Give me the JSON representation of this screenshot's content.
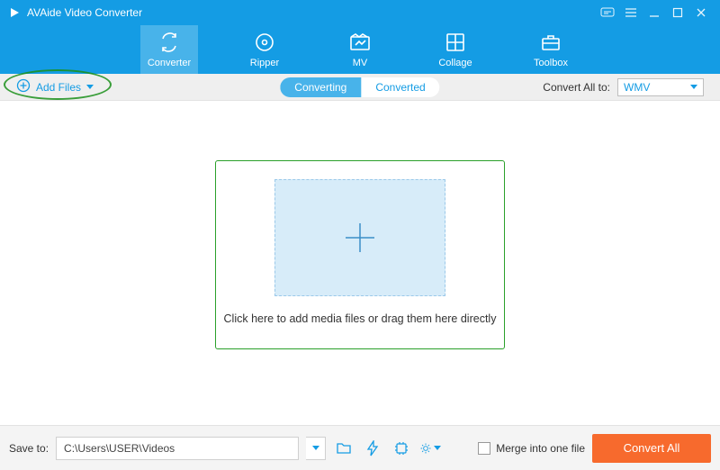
{
  "title": "AVAide Video Converter",
  "tabs": {
    "converter": "Converter",
    "ripper": "Ripper",
    "mv": "MV",
    "collage": "Collage",
    "toolbox": "Toolbox"
  },
  "subbar": {
    "add_files": "Add Files",
    "converting": "Converting",
    "converted": "Converted",
    "convert_all_to": "Convert All to:",
    "format_selected": "WMV"
  },
  "dropzone": {
    "hint": "Click here to add media files or drag them here directly"
  },
  "bottom": {
    "save_to": "Save to:",
    "path": "C:\\Users\\USER\\Videos",
    "merge": "Merge into one file",
    "convert_all": "Convert All"
  },
  "icons": {
    "feedback": "feedback-icon",
    "menu": "menu-icon",
    "minimize": "minimize-icon",
    "maximize": "maximize-icon",
    "close": "close-icon",
    "converter": "converter-icon",
    "ripper": "ripper-icon",
    "mv": "mv-icon",
    "collage": "collage-icon",
    "toolbox": "toolbox-icon",
    "plus_circle": "plus-circle-icon",
    "folder": "folder-icon",
    "lightning": "lightning-icon",
    "gpu": "gpu-icon",
    "settings": "settings-icon"
  }
}
